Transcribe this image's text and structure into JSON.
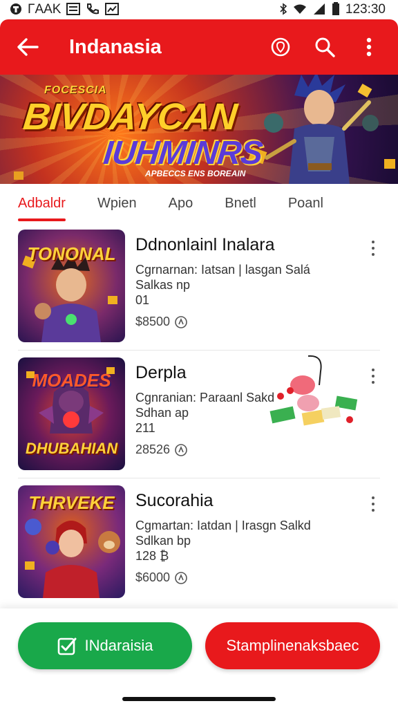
{
  "status_bar": {
    "left_text": "ΓAAK",
    "time": "123:30",
    "icons": [
      "app-icon",
      "image-icon",
      "phone-icon",
      "chart-icon",
      "bluetooth-icon",
      "wifi-icon",
      "signal-icon",
      "battery-icon"
    ]
  },
  "app_bar": {
    "title": "Indanasia",
    "icons": [
      "back-arrow-icon",
      "location-icon",
      "search-icon",
      "more-vert-icon"
    ]
  },
  "banner": {
    "title_small": "FOCESCIA",
    "title_line1": "BIVDAYCAN",
    "title_line2": "IUHMINRS",
    "subtitle": "APBECCS ENS BOREAIN"
  },
  "tabs": [
    {
      "label": "Adbaldr",
      "active": true
    },
    {
      "label": "Wpien",
      "active": false
    },
    {
      "label": "Apo",
      "active": false
    },
    {
      "label": "Bnetl",
      "active": false
    },
    {
      "label": "Poanl",
      "active": false
    }
  ],
  "items": [
    {
      "thumb_title": "TONONAL",
      "name": "Ddnonlainl Inalara",
      "line1": "Cgrnarnan: Iatsan | lasgan Salá",
      "line2": "Salkas np",
      "line3": "01",
      "price": "$8500",
      "thumb_colors": [
        "#4a2a7a",
        "#e06a20"
      ]
    },
    {
      "thumb_title": "MOADES",
      "thumb_title2": "DHUBAHIAN",
      "name": "Derpla",
      "line1": "Cgnranian: Paraanl Sakd",
      "line2": "Sdhan ap",
      "line3": "211",
      "price": "28526",
      "thumb_colors": [
        "#2a1a55",
        "#e0462a"
      ]
    },
    {
      "thumb_title": "THRVEKE",
      "name": "Sucorahia",
      "line1": "Cgmartan: Iatdan | Irasgn Salkd",
      "line2": "Sdlkan bp",
      "line3": "128 ₿",
      "price": "$6000",
      "thumb_colors": [
        "#3a2a80",
        "#e0601a"
      ]
    }
  ],
  "bottom_buttons": {
    "primary": "INdaraisia",
    "secondary": "Stamplinenaksbaec",
    "primary_color": "#19a84a",
    "secondary_color": "#e8191c"
  },
  "colors": {
    "accent": "#e8191c",
    "green": "#19a84a"
  }
}
